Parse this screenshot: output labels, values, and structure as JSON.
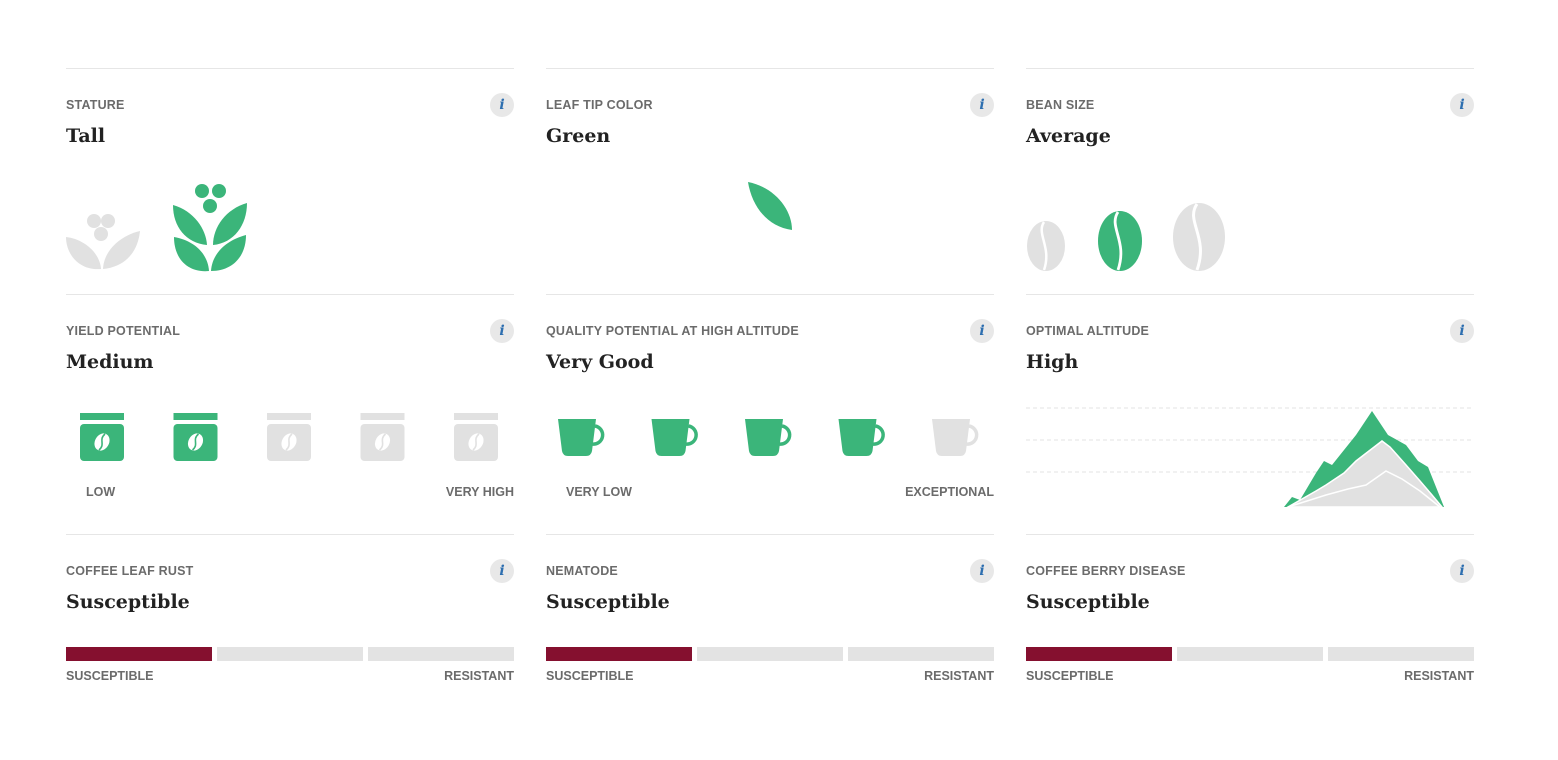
{
  "colors": {
    "green": "#3bb57a",
    "grey": "#e1e1e1",
    "red": "#85102f"
  },
  "stature": {
    "label": "STATURE",
    "value": "Tall",
    "info": "i",
    "icons": [
      "short-plant-icon",
      "tall-plant-icon"
    ],
    "selected": 1
  },
  "leaf": {
    "label": "LEAF TIP COLOR",
    "value": "Green",
    "info": "i",
    "icon": "green-leaf-icon"
  },
  "bean": {
    "label": "BEAN SIZE",
    "value": "Average",
    "info": "i",
    "icons": [
      "small-bean-icon",
      "average-bean-icon",
      "large-bean-icon"
    ],
    "selected": 1
  },
  "yield": {
    "label": "YIELD POTENTIAL",
    "value": "Medium",
    "info": "i",
    "low": "LOW",
    "high": "VERY HIGH",
    "level": 2,
    "max": 5
  },
  "quality": {
    "label": "QUALITY POTENTIAL AT HIGH ALTITUDE",
    "value": "Very Good",
    "info": "i",
    "low": "VERY LOW",
    "high": "EXCEPTIONAL",
    "level": 4,
    "max": 5
  },
  "altitude": {
    "label": "OPTIMAL ALTITUDE",
    "value": "High",
    "info": "i",
    "icon": "mountain-icon"
  },
  "rust": {
    "label": "COFFEE LEAF RUST",
    "value": "Susceptible",
    "info": "i",
    "low": "SUSCEPTIBLE",
    "high": "RESISTANT",
    "level": 1,
    "max": 3
  },
  "nematode": {
    "label": "NEMATODE",
    "value": "Susceptible",
    "info": "i",
    "low": "SUSCEPTIBLE",
    "high": "RESISTANT",
    "level": 1,
    "max": 3
  },
  "berry": {
    "label": "COFFEE BERRY DISEASE",
    "value": "Susceptible",
    "info": "i",
    "low": "SUSCEPTIBLE",
    "high": "RESISTANT",
    "level": 1,
    "max": 3
  }
}
